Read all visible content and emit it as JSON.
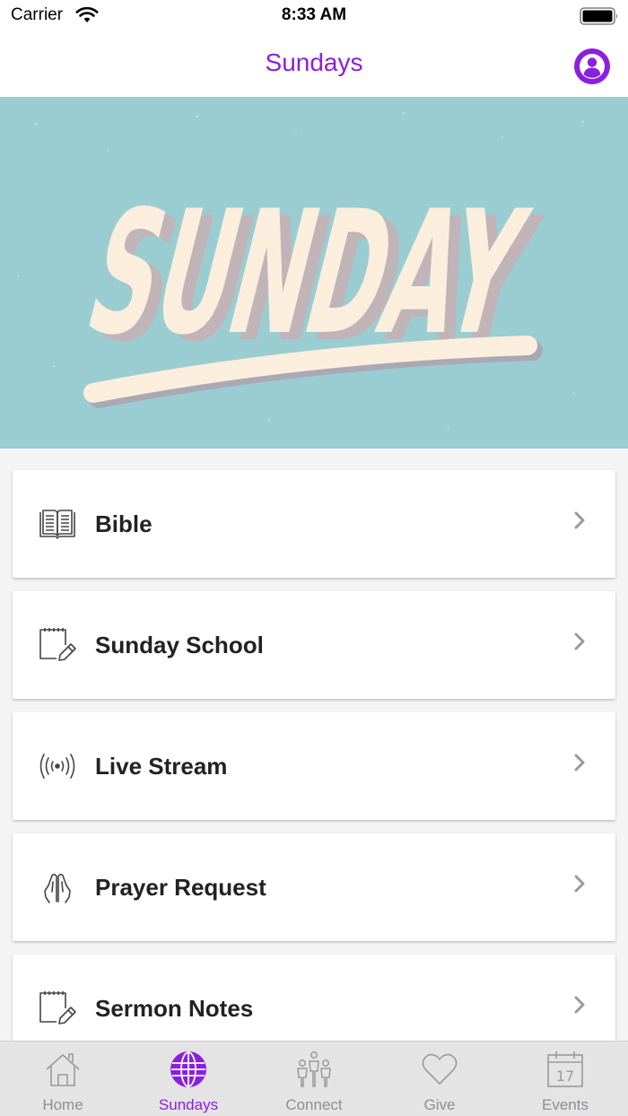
{
  "status_bar": {
    "carrier": "Carrier",
    "time": "8:33 AM"
  },
  "nav": {
    "title": "Sundays",
    "profile_icon": "person-circle-icon"
  },
  "hero": {
    "text": "SUNDAY",
    "background_color": "#99cdd2",
    "lettering_color": "#fbeedd"
  },
  "menu": {
    "items": [
      {
        "label": "Bible",
        "icon": "open-book-icon"
      },
      {
        "label": "Sunday School",
        "icon": "notepad-pencil-icon"
      },
      {
        "label": "Live Stream",
        "icon": "broadcast-icon"
      },
      {
        "label": "Prayer Request",
        "icon": "praying-hands-icon"
      },
      {
        "label": "Sermon Notes",
        "icon": "notepad-pencil-icon"
      }
    ]
  },
  "tabs": [
    {
      "label": "Home",
      "icon": "house-icon",
      "active": false
    },
    {
      "label": "Sundays",
      "icon": "globe-icon",
      "active": true
    },
    {
      "label": "Connect",
      "icon": "people-icon",
      "active": false
    },
    {
      "label": "Give",
      "icon": "heart-icon",
      "active": false
    },
    {
      "label": "Events",
      "icon": "calendar-icon",
      "active": false,
      "calendar_day": "17"
    }
  ],
  "colors": {
    "accent": "#8b1fe0",
    "tab_inactive": "#8e8e93"
  }
}
